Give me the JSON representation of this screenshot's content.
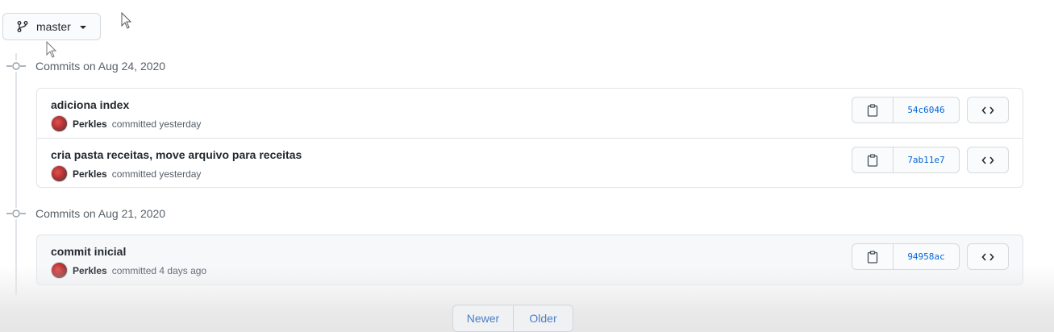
{
  "branch": {
    "label": "master"
  },
  "groups": [
    {
      "header": "Commits on Aug 24, 2020",
      "commits": [
        {
          "message": "adiciona index",
          "author": "Perkles",
          "time": "committed yesterday",
          "sha": "54c6046"
        },
        {
          "message": "cria pasta receitas, move arquivo para receitas",
          "author": "Perkles",
          "time": "committed yesterday",
          "sha": "7ab11e7"
        }
      ]
    },
    {
      "header": "Commits on Aug 21, 2020",
      "commits": [
        {
          "message": "commit inicial",
          "author": "Perkles",
          "time": "committed 4 days ago",
          "sha": "94958ac"
        }
      ]
    }
  ],
  "pagination": {
    "newer": "Newer",
    "older": "Older"
  },
  "icons": {
    "branch": "git-branch-icon",
    "commit_node": "git-commit-icon",
    "copy": "clipboard-icon",
    "browse": "code-icon",
    "cursor": "mouse-pointer-icon"
  },
  "colors": {
    "sha_link": "#0366d6",
    "pagination_text": "#4a7fc4"
  }
}
